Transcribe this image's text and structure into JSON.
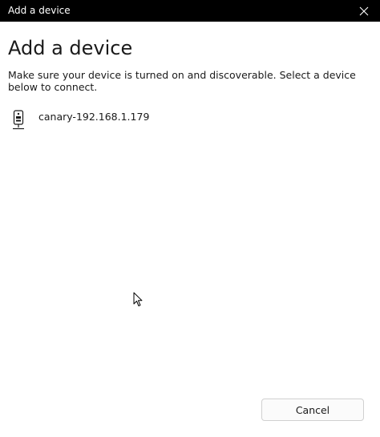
{
  "window": {
    "title": "Add a device"
  },
  "page": {
    "heading": "Add a device",
    "description": "Make sure your device is turned on and discoverable. Select a device below to connect."
  },
  "devices": [
    {
      "name": "canary-192.168.1.179",
      "icon": "device-camera-icon"
    }
  ],
  "actions": {
    "cancel_label": "Cancel"
  },
  "colors": {
    "titlebar": "#000000",
    "accent": "#0067c0",
    "text": "#1a1a1a"
  }
}
